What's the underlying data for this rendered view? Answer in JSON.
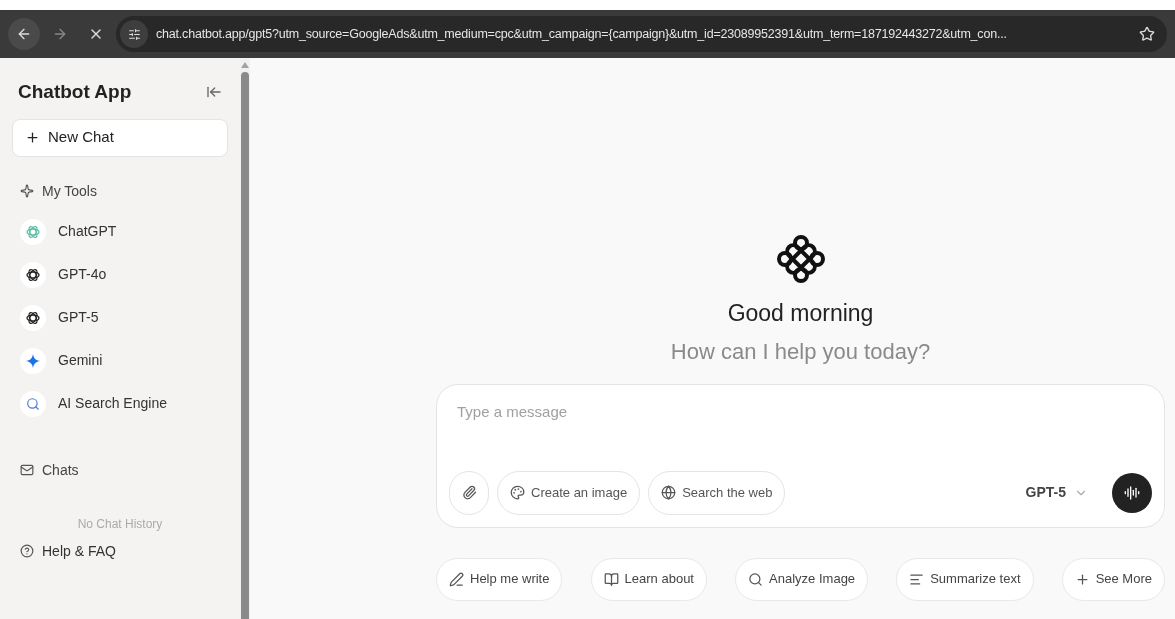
{
  "browser": {
    "url": "chat.chatbot.app/gpt5?utm_source=GoogleAds&utm_medium=cpc&utm_campaign={campaign}&utm_id=23089952391&utm_term=187192443272&utm_con..."
  },
  "sidebar": {
    "title": "Chatbot App",
    "new_chat": "New Chat",
    "tools_heading": "My Tools",
    "tools": [
      {
        "label": "ChatGPT",
        "kind": "chatgpt"
      },
      {
        "label": "GPT-4o",
        "kind": "openai"
      },
      {
        "label": "GPT-5",
        "kind": "openai"
      },
      {
        "label": "Gemini",
        "kind": "gemini"
      },
      {
        "label": "AI Search Engine",
        "kind": "search"
      }
    ],
    "chats_heading": "Chats",
    "empty_history": "No Chat History",
    "help": "Help & FAQ"
  },
  "main": {
    "greeting": "Good morning",
    "subtitle": "How can I help you today?",
    "composer": {
      "placeholder": "Type a message",
      "tools": [
        {
          "label": "Create an image",
          "kind": "palette"
        },
        {
          "label": "Search the web",
          "kind": "globe"
        }
      ],
      "model": "GPT-5"
    },
    "suggestions": [
      {
        "label": "Help me write",
        "kind": "pencil"
      },
      {
        "label": "Learn about",
        "kind": "book"
      },
      {
        "label": "Analyze Image",
        "kind": "search"
      },
      {
        "label": "Summarize text",
        "kind": "lines"
      },
      {
        "label": "See More",
        "kind": "plus"
      }
    ]
  }
}
